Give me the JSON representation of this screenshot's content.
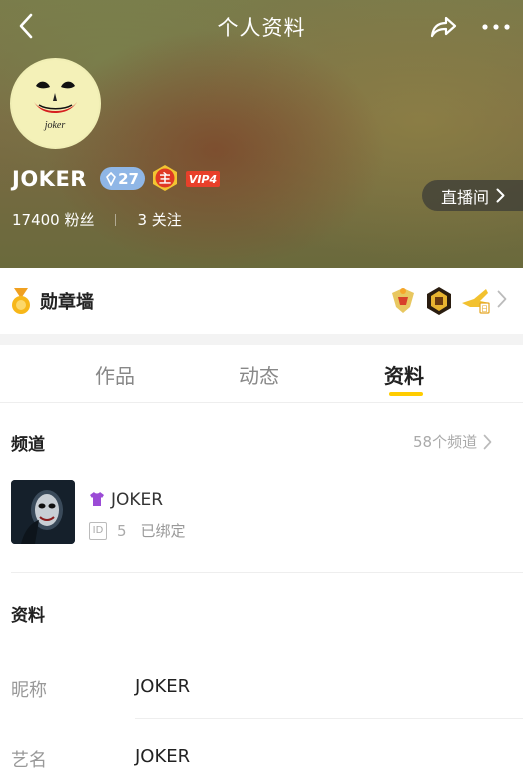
{
  "header": {
    "title": "个人资料",
    "nickname": "JOKER",
    "level": "27",
    "anchor_badge": "主",
    "vip": "VIP4",
    "followers": "17400 粉丝",
    "following": "3 关注",
    "live_room_label": "直播间",
    "avatar_text": "joker"
  },
  "medal_wall": {
    "label": "勋章墙",
    "medal_texts": [
      "",
      "",
      "日"
    ]
  },
  "tabs": [
    {
      "label": "作品",
      "active": false
    },
    {
      "label": "动态",
      "active": false
    },
    {
      "label": "资料",
      "active": true
    }
  ],
  "channels": {
    "title": "频道",
    "count_label": "58个频道",
    "item": {
      "name": "JOKER",
      "id_label": "ID",
      "id_value": "5",
      "status": "已绑定"
    }
  },
  "profile": {
    "title": "资料",
    "rows": [
      {
        "label": "昵称",
        "value": "JOKER"
      },
      {
        "label": "艺名",
        "value": "JOKER"
      }
    ]
  },
  "colors": {
    "accent": "#ffcc00",
    "vip": "#e8402a",
    "level_badge": "#8fb6e6"
  },
  "icons": {
    "back": "back-arrow-icon",
    "share": "share-icon",
    "more": "more-icon",
    "medal": "medal-icon",
    "chevron": "chevron-right-icon",
    "shirt": "shirt-icon"
  }
}
